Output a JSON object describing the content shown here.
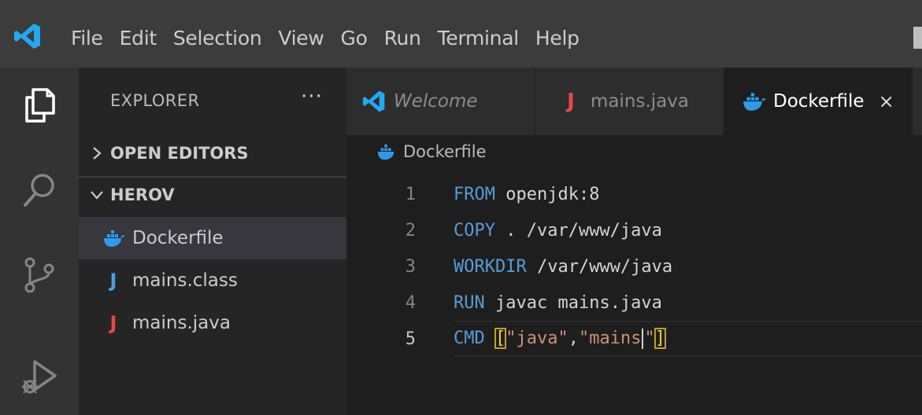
{
  "menu": [
    "File",
    "Edit",
    "Selection",
    "View",
    "Go",
    "Run",
    "Terminal",
    "Help"
  ],
  "sidebar": {
    "title": "EXPLORER",
    "more": "···",
    "sections": {
      "open_editors": "OPEN EDITORS",
      "folder": "HEROV"
    },
    "files": [
      {
        "name": "Dockerfile",
        "icon": "docker-icon",
        "selected": true
      },
      {
        "name": "mains.class",
        "icon": "java-class-icon",
        "selected": false
      },
      {
        "name": "mains.java",
        "icon": "java-icon",
        "selected": false
      }
    ]
  },
  "tabs": [
    {
      "label": "Welcome",
      "icon": "vscode-icon"
    },
    {
      "label": "mains.java",
      "icon": "java-icon",
      "glyph": "J"
    },
    {
      "label": "Dockerfile",
      "icon": "docker-icon",
      "close": "×"
    }
  ],
  "breadcrumb": "Dockerfile",
  "code": {
    "line_numbers": [
      "1",
      "2",
      "3",
      "4",
      "5"
    ],
    "lines": [
      {
        "keyword": "FROM",
        "rest": " openjdk:8"
      },
      {
        "keyword": "COPY",
        "rest": " . /var/www/java"
      },
      {
        "keyword": "WORKDIR",
        "rest": " /var/www/java"
      },
      {
        "keyword": "RUN",
        "rest": " javac mains.java"
      },
      {
        "keyword": "CMD",
        "open": "[",
        "str1": "\"java\"",
        "comma": ",",
        "str2a": "\"mains",
        "str2b": "\"",
        "close": "]"
      }
    ]
  },
  "file_glyphs": {
    "java": "J"
  },
  "colors": {
    "keyword": "#569cd6",
    "string": "#ce9178",
    "java_red": "#e8484a",
    "java_blue": "#4f9ce3",
    "docker_blue": "#2d9bea",
    "vscode_blue": "#23a9f2"
  }
}
